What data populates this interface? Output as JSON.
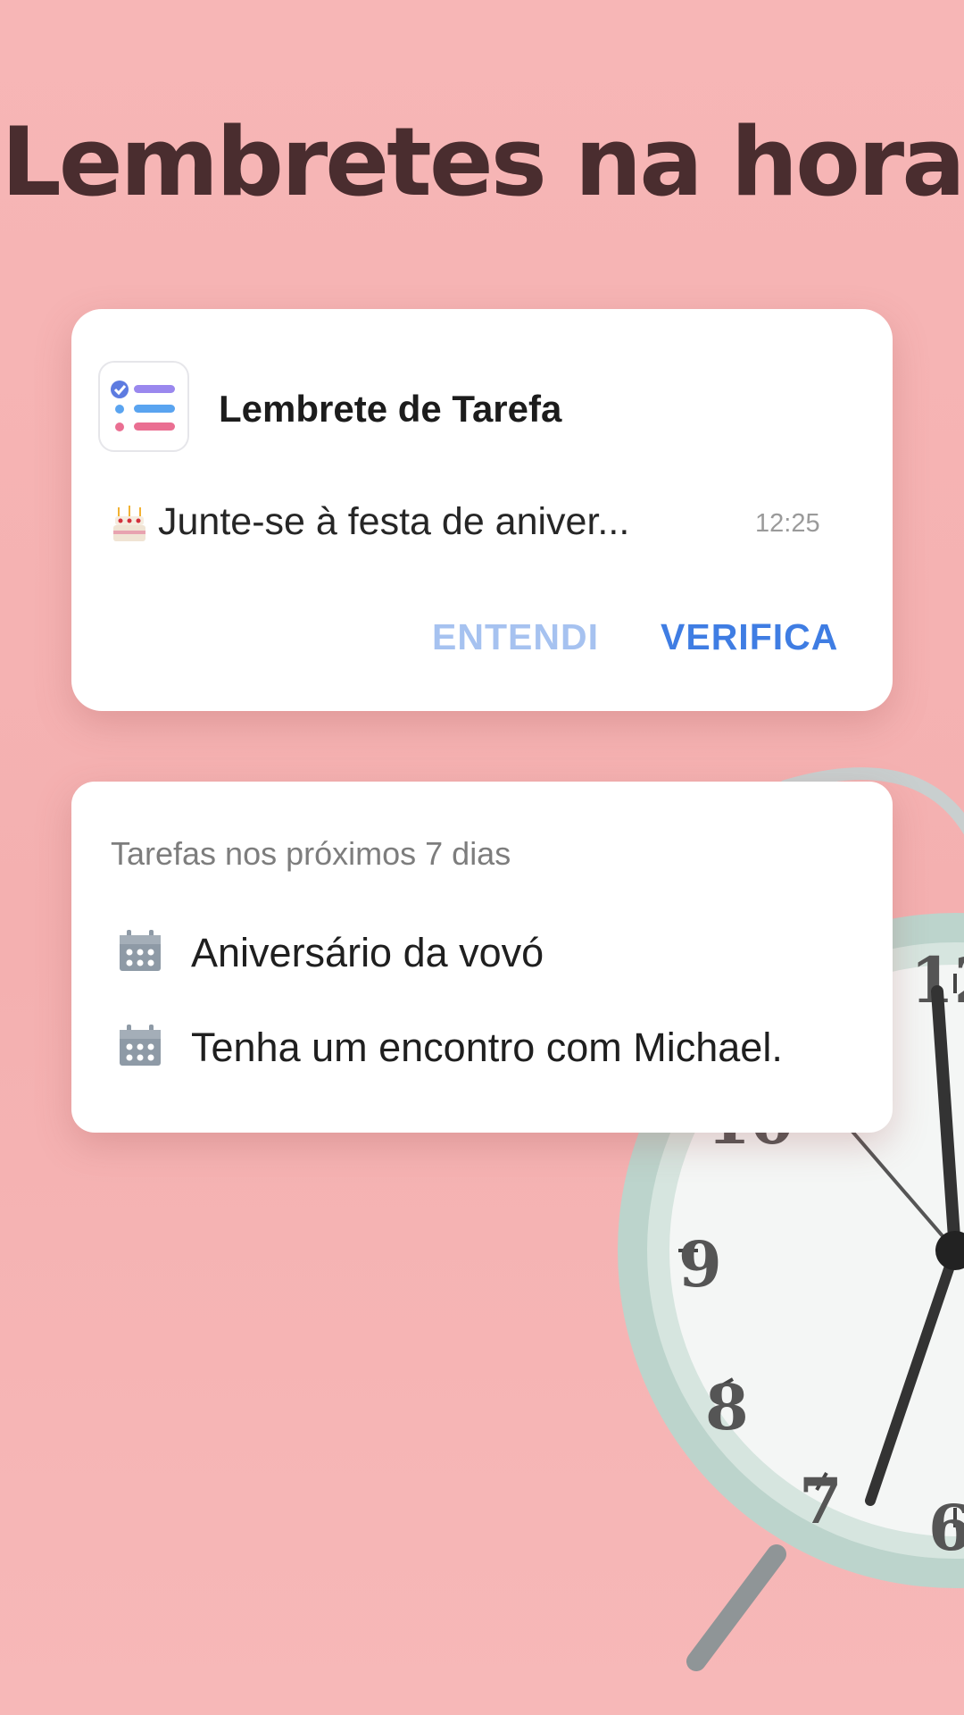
{
  "headline": "Lembretes na hora",
  "notification": {
    "app_icon": "checklist-icon",
    "app_name": "Lembrete de Tarefa",
    "emoji_icon": "birthday-cake-icon",
    "message": "Junte-se à festa de aniver...",
    "time": "12:25",
    "actions": {
      "dismiss": "ENTENDI",
      "check": "VERIFICA"
    }
  },
  "tasks_widget": {
    "heading": "Tarefas nos próximos 7 dias",
    "item_icon": "calendar-icon",
    "items": [
      {
        "label": "Aniversário da vovó"
      },
      {
        "label": "Tenha um encontro com Michael."
      }
    ]
  },
  "colors": {
    "background": "#f6b3b3",
    "headline": "#4a2d2f",
    "action_primary": "#3f7de3",
    "action_secondary": "#a6c2f0"
  }
}
